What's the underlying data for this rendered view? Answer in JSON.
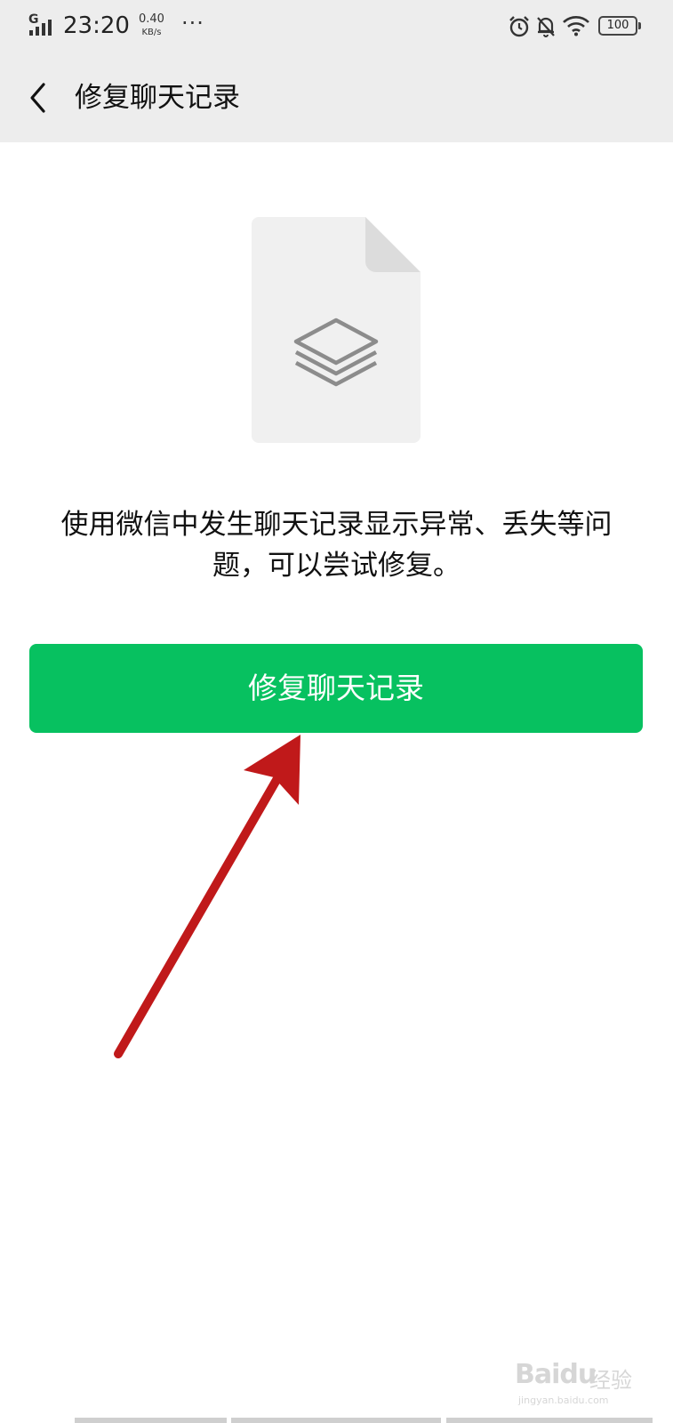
{
  "status_bar": {
    "network_type": "G",
    "time": "23:20",
    "speed_value": "0.40",
    "speed_unit": "KB/s",
    "more": "···",
    "battery": "100",
    "icons": [
      "signal-icon",
      "alarm-icon",
      "bell-off-icon",
      "wifi-icon",
      "battery-icon"
    ]
  },
  "navbar": {
    "back_icon": "chevron-left-icon",
    "title": "修复聊天记录"
  },
  "main": {
    "illustration_icon": "document-layers-icon",
    "description": "使用微信中发生聊天记录显示异常、丢失等问题，可以尝试修复。",
    "repair_button_label": "修复聊天记录"
  },
  "annotation": {
    "arrow_color": "#c0191a"
  },
  "watermark": {
    "brand": "Baidu",
    "cn": "经验",
    "url": "jingyan.baidu.com"
  },
  "colors": {
    "accent_green": "#07c160",
    "header_bg": "#ededed"
  }
}
